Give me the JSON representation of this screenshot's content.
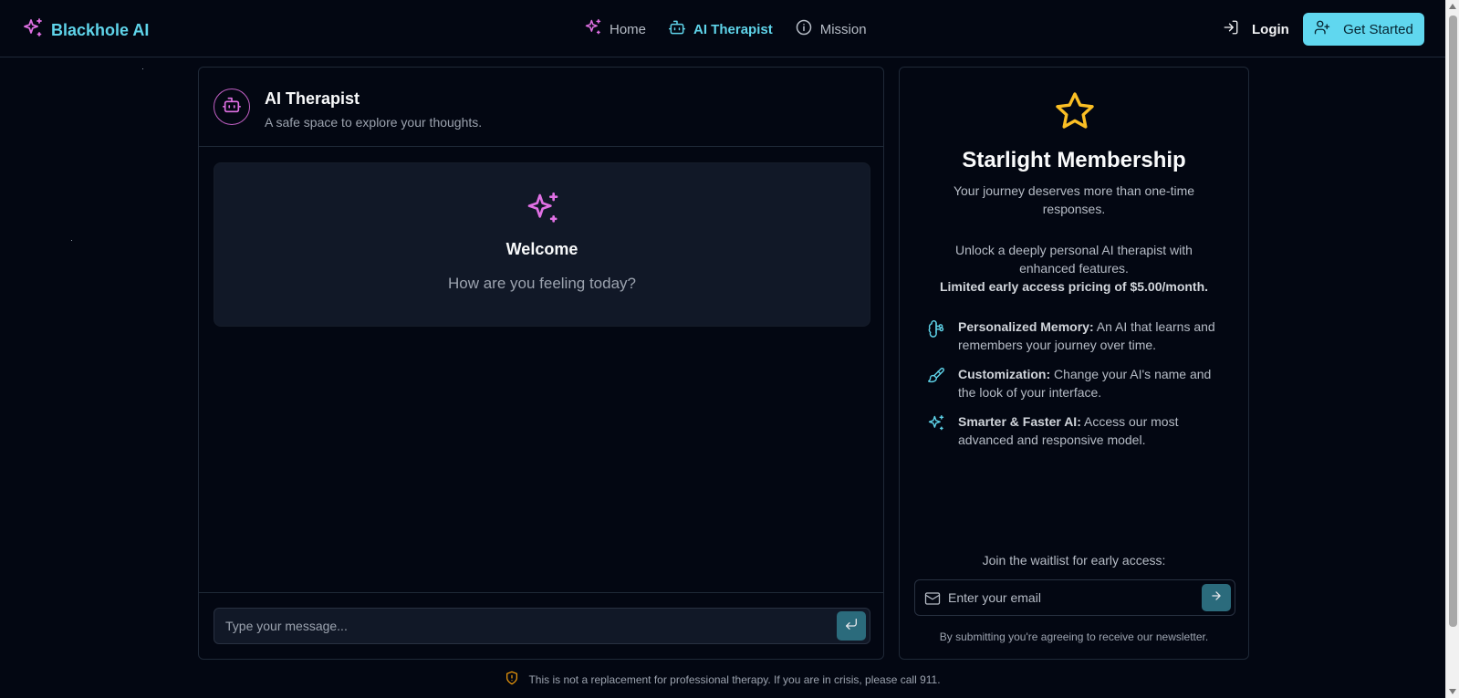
{
  "header": {
    "brand": "Blackhole AI",
    "nav": [
      {
        "label": "Home",
        "icon": "sparkles-icon"
      },
      {
        "label": "AI Therapist",
        "icon": "bot-icon"
      },
      {
        "label": "Mission",
        "icon": "info-icon"
      }
    ],
    "active_nav": "AI Therapist",
    "login_label": "Login",
    "get_started_label": "Get Started"
  },
  "chat": {
    "title": "AI Therapist",
    "subtitle": "A safe space to explore your thoughts.",
    "welcome_title": "Welcome",
    "welcome_subtitle": "How are you feeling today?",
    "input_placeholder": "Type your message..."
  },
  "membership": {
    "title": "Starlight Membership",
    "intro": "Your journey deserves more than one-time responses.",
    "unlock": "Unlock a deeply personal AI therapist with enhanced features.",
    "pricing": "Limited early access pricing of $5.00/month.",
    "features": [
      {
        "title": "Personalized Memory:",
        "text": "An AI that learns and remembers your journey over time.",
        "icon": "brain-icon"
      },
      {
        "title": "Customization:",
        "text": "Change your AI's name and the look of your interface.",
        "icon": "paintbrush-icon"
      },
      {
        "title": "Smarter & Faster AI:",
        "text": "Access our most advanced and responsive model.",
        "icon": "sparkles-icon"
      }
    ],
    "waitlist_label": "Join the waitlist for early access:",
    "email_placeholder": "Enter your email",
    "newsletter_note": "By submitting you're agreeing to receive our newsletter."
  },
  "disclaimer": "This is not a replacement for professional therapy. If you are in crisis, please call 911.",
  "colors": {
    "background": "#030712",
    "accent_cyan": "#60d7ef",
    "accent_pink": "#e070e4",
    "star_gold": "#fbbf24",
    "warning": "#f59e0b"
  }
}
